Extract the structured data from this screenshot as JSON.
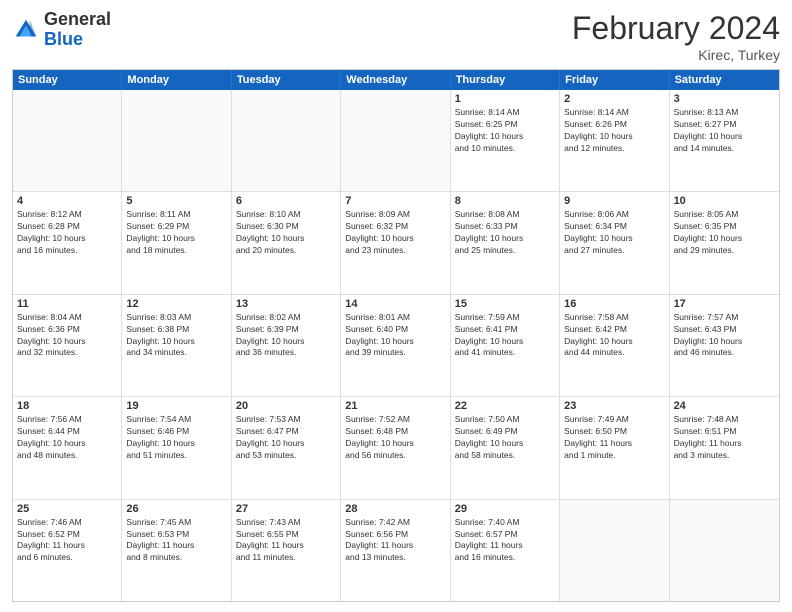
{
  "header": {
    "logo_general": "General",
    "logo_blue": "Blue",
    "month_title": "February 2024",
    "location": "Kirec, Turkey"
  },
  "weekdays": [
    "Sunday",
    "Monday",
    "Tuesday",
    "Wednesday",
    "Thursday",
    "Friday",
    "Saturday"
  ],
  "rows": [
    [
      {
        "day": "",
        "info": ""
      },
      {
        "day": "",
        "info": ""
      },
      {
        "day": "",
        "info": ""
      },
      {
        "day": "",
        "info": ""
      },
      {
        "day": "1",
        "info": "Sunrise: 8:14 AM\nSunset: 6:25 PM\nDaylight: 10 hours\nand 10 minutes."
      },
      {
        "day": "2",
        "info": "Sunrise: 8:14 AM\nSunset: 6:26 PM\nDaylight: 10 hours\nand 12 minutes."
      },
      {
        "day": "3",
        "info": "Sunrise: 8:13 AM\nSunset: 6:27 PM\nDaylight: 10 hours\nand 14 minutes."
      }
    ],
    [
      {
        "day": "4",
        "info": "Sunrise: 8:12 AM\nSunset: 6:28 PM\nDaylight: 10 hours\nand 16 minutes."
      },
      {
        "day": "5",
        "info": "Sunrise: 8:11 AM\nSunset: 6:29 PM\nDaylight: 10 hours\nand 18 minutes."
      },
      {
        "day": "6",
        "info": "Sunrise: 8:10 AM\nSunset: 6:30 PM\nDaylight: 10 hours\nand 20 minutes."
      },
      {
        "day": "7",
        "info": "Sunrise: 8:09 AM\nSunset: 6:32 PM\nDaylight: 10 hours\nand 23 minutes."
      },
      {
        "day": "8",
        "info": "Sunrise: 8:08 AM\nSunset: 6:33 PM\nDaylight: 10 hours\nand 25 minutes."
      },
      {
        "day": "9",
        "info": "Sunrise: 8:06 AM\nSunset: 6:34 PM\nDaylight: 10 hours\nand 27 minutes."
      },
      {
        "day": "10",
        "info": "Sunrise: 8:05 AM\nSunset: 6:35 PM\nDaylight: 10 hours\nand 29 minutes."
      }
    ],
    [
      {
        "day": "11",
        "info": "Sunrise: 8:04 AM\nSunset: 6:36 PM\nDaylight: 10 hours\nand 32 minutes."
      },
      {
        "day": "12",
        "info": "Sunrise: 8:03 AM\nSunset: 6:38 PM\nDaylight: 10 hours\nand 34 minutes."
      },
      {
        "day": "13",
        "info": "Sunrise: 8:02 AM\nSunset: 6:39 PM\nDaylight: 10 hours\nand 36 minutes."
      },
      {
        "day": "14",
        "info": "Sunrise: 8:01 AM\nSunset: 6:40 PM\nDaylight: 10 hours\nand 39 minutes."
      },
      {
        "day": "15",
        "info": "Sunrise: 7:59 AM\nSunset: 6:41 PM\nDaylight: 10 hours\nand 41 minutes."
      },
      {
        "day": "16",
        "info": "Sunrise: 7:58 AM\nSunset: 6:42 PM\nDaylight: 10 hours\nand 44 minutes."
      },
      {
        "day": "17",
        "info": "Sunrise: 7:57 AM\nSunset: 6:43 PM\nDaylight: 10 hours\nand 46 minutes."
      }
    ],
    [
      {
        "day": "18",
        "info": "Sunrise: 7:56 AM\nSunset: 6:44 PM\nDaylight: 10 hours\nand 48 minutes."
      },
      {
        "day": "19",
        "info": "Sunrise: 7:54 AM\nSunset: 6:46 PM\nDaylight: 10 hours\nand 51 minutes."
      },
      {
        "day": "20",
        "info": "Sunrise: 7:53 AM\nSunset: 6:47 PM\nDaylight: 10 hours\nand 53 minutes."
      },
      {
        "day": "21",
        "info": "Sunrise: 7:52 AM\nSunset: 6:48 PM\nDaylight: 10 hours\nand 56 minutes."
      },
      {
        "day": "22",
        "info": "Sunrise: 7:50 AM\nSunset: 6:49 PM\nDaylight: 10 hours\nand 58 minutes."
      },
      {
        "day": "23",
        "info": "Sunrise: 7:49 AM\nSunset: 6:50 PM\nDaylight: 11 hours\nand 1 minute."
      },
      {
        "day": "24",
        "info": "Sunrise: 7:48 AM\nSunset: 6:51 PM\nDaylight: 11 hours\nand 3 minutes."
      }
    ],
    [
      {
        "day": "25",
        "info": "Sunrise: 7:46 AM\nSunset: 6:52 PM\nDaylight: 11 hours\nand 6 minutes."
      },
      {
        "day": "26",
        "info": "Sunrise: 7:45 AM\nSunset: 6:53 PM\nDaylight: 11 hours\nand 8 minutes."
      },
      {
        "day": "27",
        "info": "Sunrise: 7:43 AM\nSunset: 6:55 PM\nDaylight: 11 hours\nand 11 minutes."
      },
      {
        "day": "28",
        "info": "Sunrise: 7:42 AM\nSunset: 6:56 PM\nDaylight: 11 hours\nand 13 minutes."
      },
      {
        "day": "29",
        "info": "Sunrise: 7:40 AM\nSunset: 6:57 PM\nDaylight: 11 hours\nand 16 minutes."
      },
      {
        "day": "",
        "info": ""
      },
      {
        "day": "",
        "info": ""
      }
    ]
  ]
}
